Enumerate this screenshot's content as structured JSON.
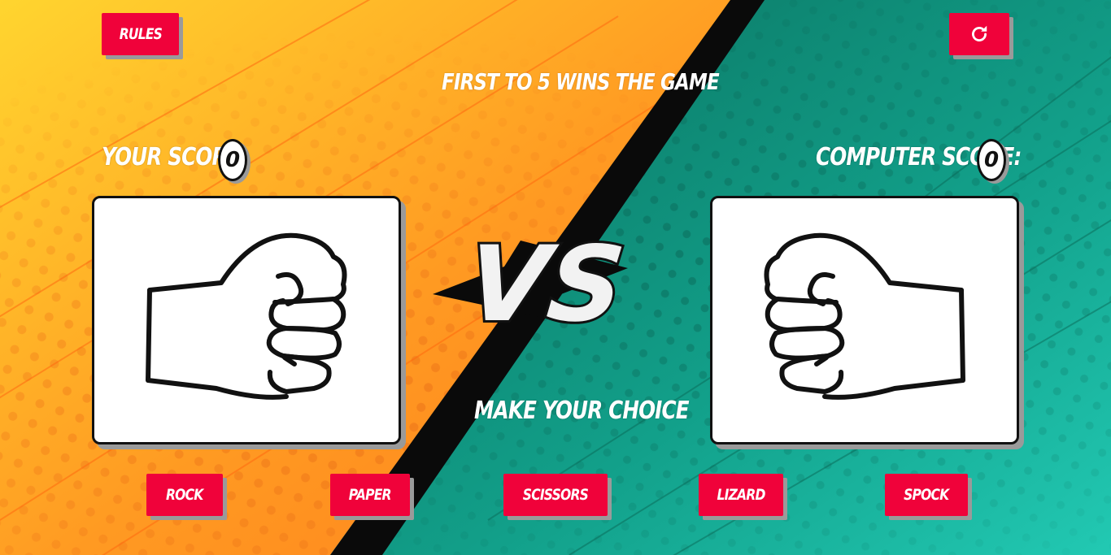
{
  "header": {
    "rules_label": "Rules",
    "restart_icon": "restart-icon",
    "subtitle": "First to 5 wins the game"
  },
  "player": {
    "score_label": "Your Score:",
    "score": "0",
    "choice_icon": "fist-icon"
  },
  "computer": {
    "score_label": "Computer Score:",
    "score": "0",
    "choice_icon": "fist-icon"
  },
  "versus": {
    "text": "VS"
  },
  "prompt": "Make your choice",
  "choices": [
    {
      "label": "Rock"
    },
    {
      "label": "Paper"
    },
    {
      "label": "Scissors"
    },
    {
      "label": "Lizard"
    },
    {
      "label": "Spock"
    }
  ],
  "colors": {
    "button": "#f0023a",
    "left_bg_start": "#ffd12e",
    "left_bg_end": "#ff8a1e",
    "right_bg_start": "#0b7a66",
    "right_bg_end": "#1ec3ad",
    "divider": "#0a0a0a"
  }
}
